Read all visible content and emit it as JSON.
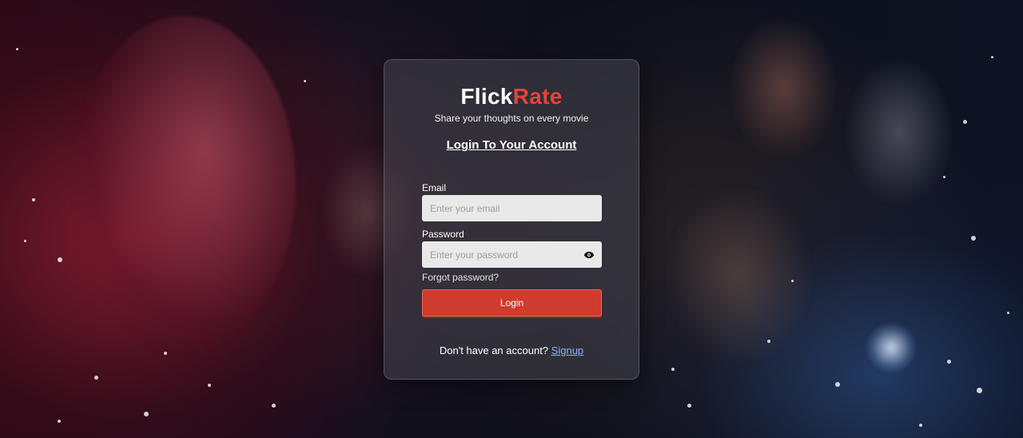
{
  "brand": {
    "name_part1": "Flick",
    "name_part2": "Rate",
    "accent_color": "#e2453b"
  },
  "tagline": "Share your thoughts on every movie",
  "heading": "Login To Your Account",
  "form": {
    "email_label": "Email",
    "email_placeholder": "Enter your email",
    "email_value": "",
    "password_label": "Password",
    "password_placeholder": "Enter your password",
    "password_value": "",
    "toggle_icon": "eye-icon",
    "forgot_label": "Forgot password?",
    "login_label": "Login"
  },
  "signup": {
    "prompt": "Don't have an account?",
    "link_label": "Signup"
  },
  "colors": {
    "button": "#cf3b2c",
    "link": "#8fb2ff"
  }
}
